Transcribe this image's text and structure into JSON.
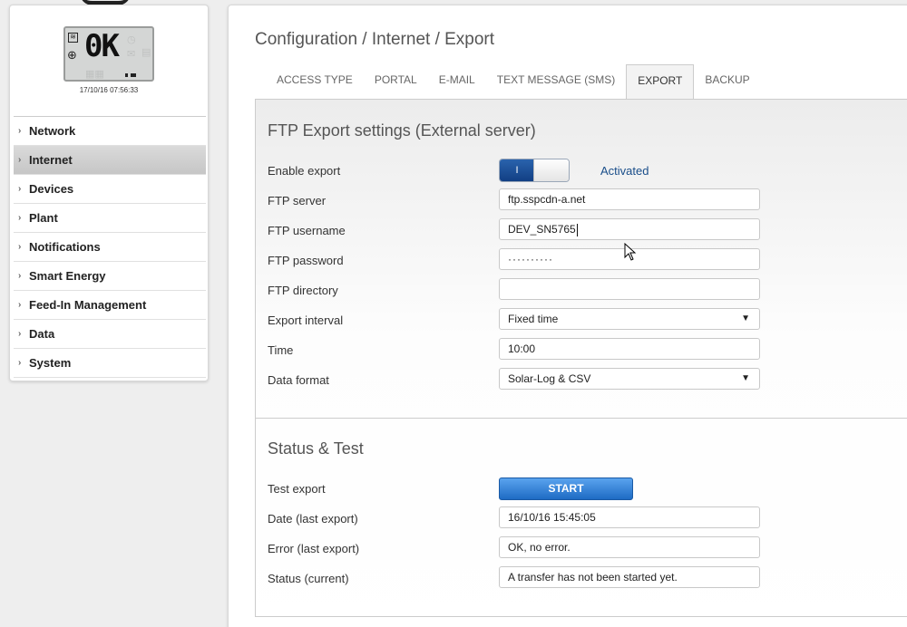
{
  "device": {
    "lcd_text": "0K",
    "timestamp": "17/10/16 07:56:33"
  },
  "nav": {
    "items": [
      {
        "label": "Network"
      },
      {
        "label": "Internet"
      },
      {
        "label": "Devices"
      },
      {
        "label": "Plant"
      },
      {
        "label": "Notifications"
      },
      {
        "label": "Smart Energy"
      },
      {
        "label": "Feed-In Management"
      },
      {
        "label": "Data"
      },
      {
        "label": "System"
      }
    ],
    "active": "Internet"
  },
  "breadcrumb": "Configuration / Internet / Export",
  "tabs": [
    {
      "label": "ACCESS TYPE"
    },
    {
      "label": "PORTAL"
    },
    {
      "label": "E-MAIL"
    },
    {
      "label": "TEXT MESSAGE (SMS)"
    },
    {
      "label": "EXPORT"
    },
    {
      "label": "BACKUP"
    }
  ],
  "active_tab": "EXPORT",
  "ftp": {
    "title": "FTP Export settings (External server)",
    "enable_label": "Enable export",
    "toggle_on_text": "I",
    "toggle_status": "Activated",
    "server_label": "FTP server",
    "server_value": "ftp.sspcdn-a.net",
    "username_label": "FTP username",
    "username_value": "DEV_SN5765",
    "password_label": "FTP password",
    "password_value": "··········",
    "directory_label": "FTP directory",
    "directory_value": "",
    "interval_label": "Export interval",
    "interval_value": "Fixed time",
    "time_label": "Time",
    "time_value": "10:00",
    "format_label": "Data format",
    "format_value": "Solar-Log & CSV"
  },
  "status": {
    "title": "Status & Test",
    "test_label": "Test export",
    "start_label": "START",
    "date_label": "Date (last export)",
    "date_value": "16/10/16 15:45:05",
    "error_label": "Error (last export)",
    "error_value": "OK, no error.",
    "current_label": "Status (current)",
    "current_value": "A transfer has not been started yet."
  },
  "icons": {
    "chevron": "chevron-right-icon",
    "select": "triangle-down-icon",
    "cursor": "mouse-pointer-icon"
  }
}
